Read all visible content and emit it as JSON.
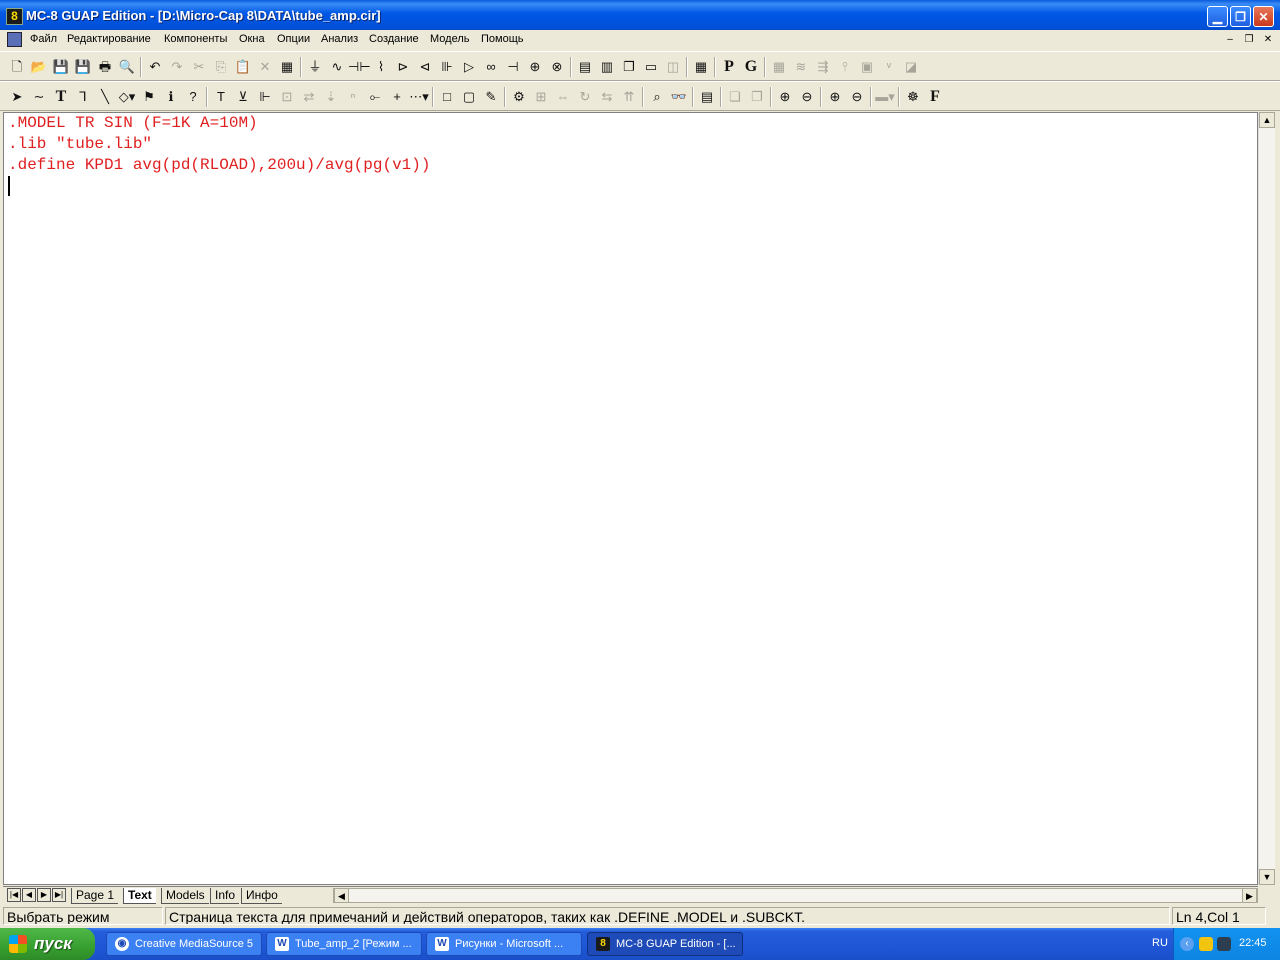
{
  "window": {
    "title": "MC-8 GUAP Edition - [D:\\Micro-Cap 8\\DATA\\tube_amp.cir]",
    "app_icon_glyph": "8"
  },
  "menu": [
    "Файл",
    "Редактирование",
    "Компоненты",
    "Окна",
    "Опции",
    "Анализ",
    "Создание",
    "Модель",
    "Помощь"
  ],
  "toolbar1": [
    {
      "icon": "new-icon",
      "g": "🗋"
    },
    {
      "icon": "open-icon",
      "g": "📂"
    },
    {
      "icon": "save-icon",
      "g": "💾"
    },
    {
      "icon": "save-all-icon",
      "g": "💾"
    },
    {
      "icon": "print-icon",
      "g": "🖶"
    },
    {
      "icon": "print-preview-icon",
      "g": "🔍"
    },
    {
      "sep": true
    },
    {
      "icon": "undo-icon",
      "g": "↶"
    },
    {
      "icon": "redo-icon",
      "g": "↷",
      "dis": true
    },
    {
      "icon": "cut-icon",
      "g": "✂",
      "dis": true
    },
    {
      "icon": "copy-icon",
      "g": "⎘",
      "dis": true
    },
    {
      "icon": "paste-icon",
      "g": "📋"
    },
    {
      "icon": "delete-icon",
      "g": "✕",
      "dis": true
    },
    {
      "icon": "select-all-icon",
      "g": "▦"
    },
    {
      "sep": true
    },
    {
      "icon": "ground-icon",
      "g": "⏚"
    },
    {
      "icon": "source-icon",
      "g": "∿"
    },
    {
      "icon": "capacitor-icon",
      "g": "⊣⊢"
    },
    {
      "icon": "resistor-icon",
      "g": "⌇"
    },
    {
      "icon": "diode-icon",
      "g": "⊳"
    },
    {
      "icon": "zener-icon",
      "g": "⊲"
    },
    {
      "icon": "transistor-icon",
      "g": "⊪"
    },
    {
      "icon": "opamp-icon",
      "g": "▷"
    },
    {
      "icon": "inductor-icon",
      "g": "∞"
    },
    {
      "icon": "battery-icon",
      "g": "⊣"
    },
    {
      "icon": "node-icon",
      "g": "⊕"
    },
    {
      "icon": "current-source-icon",
      "g": "⊗"
    },
    {
      "sep": true
    },
    {
      "icon": "tile-horizontal-icon",
      "g": "▤"
    },
    {
      "icon": "tile-vertical-icon",
      "g": "▥"
    },
    {
      "icon": "cascade-icon",
      "g": "❐"
    },
    {
      "icon": "window-icon",
      "g": "▭"
    },
    {
      "icon": "split-icon",
      "g": "◫",
      "dis": true
    },
    {
      "sep": true
    },
    {
      "icon": "calculator-icon",
      "g": "▦"
    },
    {
      "sep": true
    },
    {
      "icon": "probe-p-icon",
      "g": "P",
      "bold": true
    },
    {
      "icon": "probe-g-icon",
      "g": "G",
      "bold": true
    },
    {
      "sep": true
    },
    {
      "icon": "grid-icon",
      "g": "▦",
      "dis": true
    },
    {
      "icon": "waveform-icon",
      "g": "≋",
      "dis": true
    },
    {
      "icon": "stepping-icon",
      "g": "⇶",
      "dis": true
    },
    {
      "icon": "pin-icon",
      "g": "⫯",
      "dis": true
    },
    {
      "icon": "frame-icon",
      "g": "▣",
      "dis": true
    },
    {
      "icon": "value-icon",
      "g": "ᵛ",
      "dis": true
    },
    {
      "icon": "plot-icon",
      "g": "◪",
      "dis": true
    }
  ],
  "toolbar2": [
    {
      "icon": "select-arrow-icon",
      "g": "➤"
    },
    {
      "icon": "wire-icon",
      "g": "∼"
    },
    {
      "icon": "text-icon",
      "g": "T",
      "bold": true
    },
    {
      "icon": "ortho-wire-icon",
      "g": "⅂"
    },
    {
      "icon": "diagonal-wire-icon",
      "g": "╲"
    },
    {
      "icon": "shapes-icon",
      "g": "◇▾"
    },
    {
      "icon": "flag-icon",
      "g": "⚑"
    },
    {
      "icon": "info-icon",
      "g": "ℹ"
    },
    {
      "icon": "help-icon",
      "g": "?"
    },
    {
      "sep": true
    },
    {
      "icon": "text-mode-icon",
      "g": "T"
    },
    {
      "icon": "attribute-icon",
      "g": "⊻"
    },
    {
      "icon": "pin-names-icon",
      "g": "⊩"
    },
    {
      "icon": "node-numbers-icon",
      "g": "⊡",
      "dis": true
    },
    {
      "icon": "current-icon",
      "g": "⇄",
      "dis": true
    },
    {
      "icon": "voltage-icon",
      "g": "⇣",
      "dis": true
    },
    {
      "icon": "on-off-icon",
      "g": "ⁿ",
      "dis": true
    },
    {
      "icon": "line-icon",
      "g": "⟜"
    },
    {
      "icon": "cross-icon",
      "g": "+"
    },
    {
      "icon": "dot-grid-icon",
      "g": "⋯▾"
    },
    {
      "sep": true
    },
    {
      "icon": "rectangle-icon",
      "g": "□"
    },
    {
      "icon": "title-block-icon",
      "g": "▢"
    },
    {
      "icon": "paint-icon",
      "g": "✎"
    },
    {
      "sep": true
    },
    {
      "icon": "properties-icon",
      "g": "⚙"
    },
    {
      "icon": "box-icon",
      "g": "⊞",
      "dis": true
    },
    {
      "icon": "mirror-icon",
      "g": "⇔",
      "dis": true
    },
    {
      "icon": "rotate-icon",
      "g": "↻",
      "dis": true
    },
    {
      "icon": "flip-icon",
      "g": "⇆",
      "dis": true
    },
    {
      "icon": "step-icon",
      "g": "⇈",
      "dis": true
    },
    {
      "sep": true
    },
    {
      "icon": "find-icon",
      "g": "⌕"
    },
    {
      "icon": "binoculars-icon",
      "g": "👓"
    },
    {
      "sep": true
    },
    {
      "icon": "presentation-icon",
      "g": "▤"
    },
    {
      "sep": true
    },
    {
      "icon": "bring-front-icon",
      "g": "❏",
      "dis": true
    },
    {
      "icon": "send-back-icon",
      "g": "❐",
      "dis": true
    },
    {
      "sep": true
    },
    {
      "icon": "add-page-icon",
      "g": "⊕"
    },
    {
      "icon": "remove-page-icon",
      "g": "⊖"
    },
    {
      "sep": true
    },
    {
      "icon": "zoom-in-icon",
      "g": "⊕"
    },
    {
      "icon": "zoom-out-icon",
      "g": "⊖"
    },
    {
      "sep": true
    },
    {
      "icon": "color-icon",
      "g": "▬▾",
      "dis": true
    },
    {
      "sep": true
    },
    {
      "icon": "component-icon",
      "g": "☸"
    },
    {
      "icon": "font-icon",
      "g": "F",
      "bold": true
    }
  ],
  "editor": {
    "lines": [
      ".MODEL TR SIN (F=1K A=10M)",
      ".lib \"tube.lib\"",
      ".define KPD1 avg(pd(RLOAD),200u)/avg(pg(v1))"
    ]
  },
  "tabs": [
    "Page 1",
    "Text",
    "Models",
    "Info",
    "Инфо"
  ],
  "active_tab": "Text",
  "status": {
    "mode": "Выбрать режим",
    "hint": "Страница текста для примечаний и действий операторов, таких как .DEFINE .MODEL и .SUBCKT.",
    "position": "Ln 4,Col 1"
  },
  "taskbar": {
    "start_label": "пуск",
    "tasks": [
      {
        "label": "Creative MediaSource 5",
        "icon": "media-icon"
      },
      {
        "label": "Tube_amp_2 [Режим ...",
        "icon": "word-icon"
      },
      {
        "label": "Рисунки - Microsoft ...",
        "icon": "word-icon"
      },
      {
        "label": "MC-8 GUAP Edition - [...",
        "icon": "mc8-icon",
        "active": true
      }
    ],
    "language": "RU",
    "clock": "22:45"
  }
}
